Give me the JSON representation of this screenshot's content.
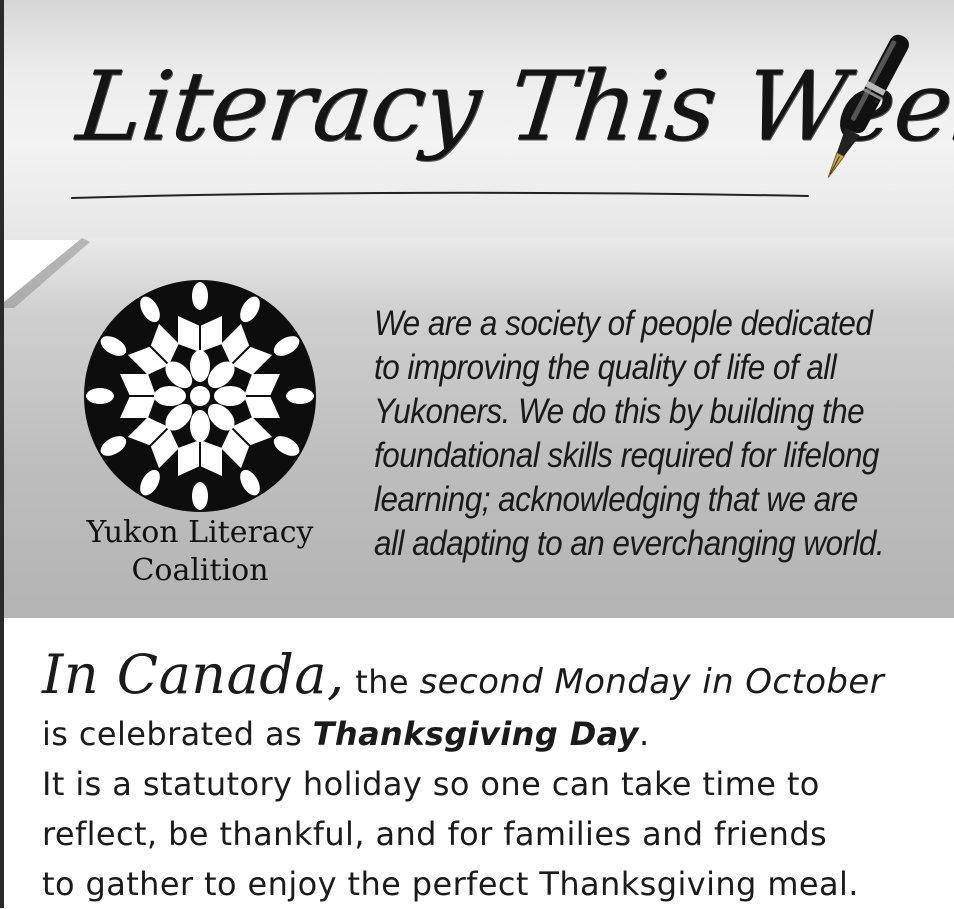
{
  "header": {
    "title": "Literacy This Week"
  },
  "mission": {
    "org_name_line1": "Yukon Literacy",
    "org_name_line2": "Coalition",
    "text_lines": [
      "We are a society of people dedicated",
      "to improving the quality of life of all",
      "Yukoners. We do this by building the",
      "foundational skills required for lifelong",
      "learning; acknowledging that we are",
      "all adapting to an everchanging world."
    ]
  },
  "article": {
    "lead": "In Canada,",
    "l1_a": " the ",
    "l1_b": "second Monday in October",
    "l2_a": "is celebrated as ",
    "l2_b": "Thanksgiving Day",
    "l2_c": ".",
    "l3": "It is a statutory holiday so one can take time to",
    "l4": "reflect, be thankful, and for families and friends",
    "l5": "to gather to enjoy the perfect Thanksgiving meal."
  },
  "colors": {
    "ink": "#141414",
    "panel_gray": "#bdbdbd",
    "header_gray": "#ececec"
  },
  "icons": [
    "fountain-pen-icon",
    "hands-books-mandala-logo"
  ]
}
